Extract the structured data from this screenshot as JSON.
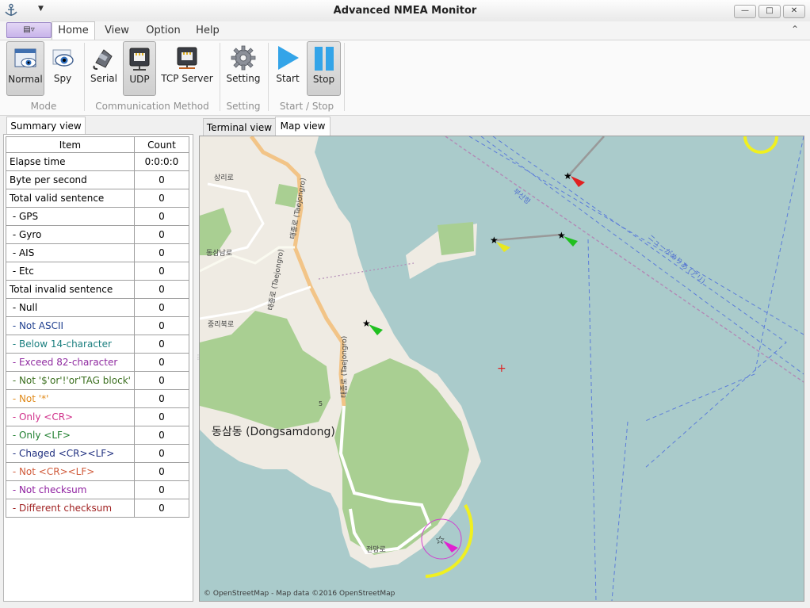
{
  "window": {
    "title": "Advanced NMEA Monitor",
    "minimize": "—",
    "maximize": "□",
    "close": "✕",
    "qat_arrow": "▼",
    "app_icon": "anchor-icon"
  },
  "menu": {
    "app_button": "▤▿",
    "tabs": [
      "Home",
      "View",
      "Option",
      "Help"
    ],
    "active_tab": "Home",
    "collapse": "⌃"
  },
  "ribbon": {
    "groups": [
      {
        "label": "Mode",
        "buttons": [
          {
            "label": "Normal",
            "icon": "window-eye-icon",
            "pressed": true
          },
          {
            "label": "Spy",
            "icon": "eye-icon",
            "pressed": false
          }
        ]
      },
      {
        "label": "Communication Method",
        "buttons": [
          {
            "label": "Serial",
            "icon": "serial-cable-icon",
            "pressed": false
          },
          {
            "label": "UDP",
            "icon": "network-port-icon",
            "pressed": true
          },
          {
            "label": "TCP Server",
            "icon": "tcp-server-icon",
            "pressed": false
          }
        ]
      },
      {
        "label": "Setting",
        "buttons": [
          {
            "label": "Setting",
            "icon": "gear-icon",
            "pressed": false
          }
        ]
      },
      {
        "label": "Start / Stop",
        "buttons": [
          {
            "label": "Start",
            "icon": "play-icon",
            "pressed": false
          },
          {
            "label": "Stop",
            "icon": "pause-icon",
            "pressed": true
          }
        ]
      }
    ]
  },
  "left_panel": {
    "tab": "Summary view",
    "columns": [
      "Item",
      "Count"
    ],
    "rows": [
      {
        "item": "Elapse time",
        "count": "0:0:0:0",
        "color": "#000000"
      },
      {
        "item": "Byte per second",
        "count": "0",
        "color": "#000000"
      },
      {
        "item": "Total valid sentence",
        "count": "0",
        "color": "#000000"
      },
      {
        "item": " - GPS",
        "count": "0",
        "color": "#000000"
      },
      {
        "item": " - Gyro",
        "count": "0",
        "color": "#000000"
      },
      {
        "item": " - AIS",
        "count": "0",
        "color": "#000000"
      },
      {
        "item": " - Etc",
        "count": "0",
        "color": "#000000"
      },
      {
        "item": "Total invalid sentence",
        "count": "0",
        "color": "#000000"
      },
      {
        "item": " - Null",
        "count": "0",
        "color": "#000000"
      },
      {
        "item": " - Not ASCII",
        "count": "0",
        "color": "#1f3f8f"
      },
      {
        "item": " - Below 14-character",
        "count": "0",
        "color": "#1b7f7f"
      },
      {
        "item": " - Exceed 82-character",
        "count": "0",
        "color": "#8f2aa0"
      },
      {
        "item": " - Not '$'or'!'or'TAG block'",
        "count": "0",
        "color": "#3b6f1f"
      },
      {
        "item": " - Not '*'",
        "count": "0",
        "color": "#e08a1a"
      },
      {
        "item": " - Only <CR>",
        "count": "0",
        "color": "#d0308a"
      },
      {
        "item": " - Only <LF>",
        "count": "0",
        "color": "#1f7f2f"
      },
      {
        "item": " - Chaged <CR><LF>",
        "count": "0",
        "color": "#1f2f7f"
      },
      {
        "item": " - Not <CR><LF>",
        "count": "0",
        "color": "#d05a3a"
      },
      {
        "item": " - Not checksum",
        "count": "0",
        "color": "#8f1fa0"
      },
      {
        "item": " - Different checksum",
        "count": "0",
        "color": "#9f1f1f"
      }
    ]
  },
  "right_panel": {
    "tabs": [
      "Terminal view",
      "Map view"
    ],
    "active_tab": "Map view"
  },
  "map": {
    "place_label": "동삼동 (Dongsamdong)",
    "road_label_1": "태종로 (Taejongro)",
    "road_label_2": "태종로 (Taejongro)",
    "road_label_3": "태종로 (Taejongro)",
    "street_1": "상리로",
    "street_2": "동삼남로",
    "street_3": "중리북로",
    "street_4": "전망로",
    "sea_label": "부산항",
    "route_label": "ニューがめりあ (アリ)",
    "road_number": "5",
    "attribution": "© OpenStreetMap - Map data ©2016 OpenStreetMap",
    "colors": {
      "sea": "#aacbcb",
      "land": "#efebe3",
      "forest": "#a9cf92",
      "road": "#f2c487",
      "route": "#5c7dd9",
      "ferry": "#b28ab6"
    }
  }
}
